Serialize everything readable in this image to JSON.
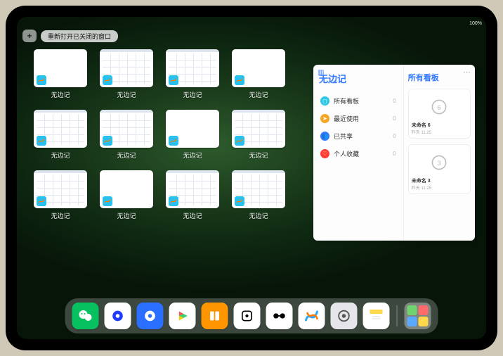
{
  "status": {
    "time": "",
    "battery": "100%"
  },
  "toolbar": {
    "plus": "+",
    "reopen_label": "重新打开已关闭的窗口"
  },
  "app_name": "无边记",
  "windows": [
    {
      "label": "无边记",
      "pattern": false
    },
    {
      "label": "无边记",
      "pattern": true
    },
    {
      "label": "无边记",
      "pattern": true
    },
    {
      "label": "无边记",
      "pattern": false
    },
    {
      "label": "无边记",
      "pattern": true
    },
    {
      "label": "无边记",
      "pattern": true
    },
    {
      "label": "无边记",
      "pattern": false
    },
    {
      "label": "无边记",
      "pattern": true
    },
    {
      "label": "无边记",
      "pattern": true
    },
    {
      "label": "无边记",
      "pattern": false
    },
    {
      "label": "无边记",
      "pattern": true
    },
    {
      "label": "无边记",
      "pattern": true
    }
  ],
  "sidebar": {
    "title": "无边记",
    "items": [
      {
        "label": "所有看板",
        "count": "0",
        "color": "#2bc6e6",
        "glyph": "◻"
      },
      {
        "label": "最近使用",
        "count": "0",
        "color": "#f5a623",
        "glyph": "➤"
      },
      {
        "label": "已共享",
        "count": "0",
        "color": "#2f78ff",
        "glyph": "👥"
      },
      {
        "label": "个人收藏",
        "count": "0",
        "color": "#ff3b30",
        "glyph": "♡"
      }
    ]
  },
  "right_panel": {
    "title": "所有看板",
    "boards": [
      {
        "name": "未命名 6",
        "date": "昨天 11:25",
        "digit": "6"
      },
      {
        "name": "未命名 3",
        "date": "昨天 11:25",
        "digit": "3"
      }
    ]
  },
  "dock": [
    {
      "name": "wechat",
      "bg": "#07c160",
      "glyph": "wechat"
    },
    {
      "name": "quark-hd",
      "bg": "#ffffff",
      "glyph": "circle-blue"
    },
    {
      "name": "quark",
      "bg": "#2a6fff",
      "glyph": "circle-white"
    },
    {
      "name": "play",
      "bg": "#ffffff",
      "glyph": "play"
    },
    {
      "name": "books",
      "bg": "#ff9500",
      "glyph": "books"
    },
    {
      "name": "game",
      "bg": "#ffffff",
      "glyph": "square-dot"
    },
    {
      "name": "remote",
      "bg": "#ffffff",
      "glyph": "dumbbell"
    },
    {
      "name": "freeform",
      "bg": "#ffffff",
      "glyph": "scribble"
    },
    {
      "name": "settings",
      "bg": "#e5e5ea",
      "glyph": "gear"
    },
    {
      "name": "notes",
      "bg": "#ffffff",
      "glyph": "notes"
    }
  ],
  "dock_folder": {
    "minis": [
      "#6fd36f",
      "#ff6b6b",
      "#5aa9ff",
      "#ffd94a"
    ]
  }
}
